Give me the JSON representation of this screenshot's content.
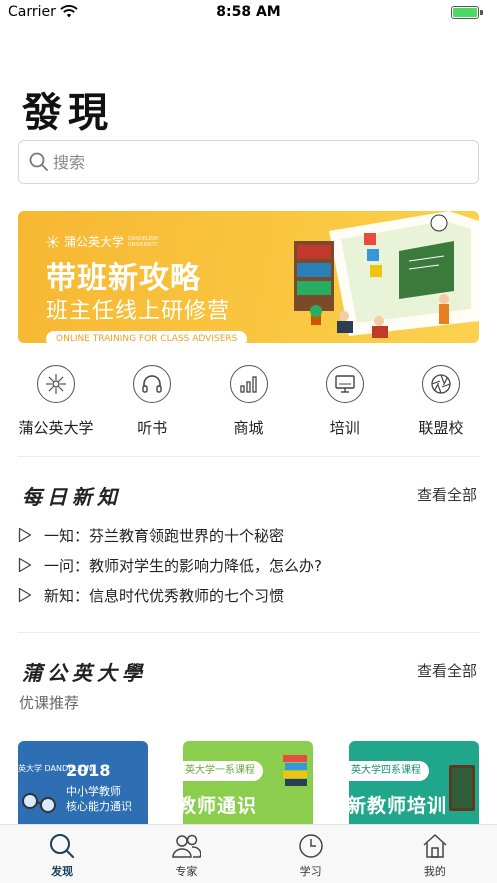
{
  "status_bar": {
    "carrier": "Carrier",
    "time": "8:58 AM",
    "battery_level": 1.0
  },
  "page": {
    "title": "發現"
  },
  "search": {
    "placeholder": "搜索"
  },
  "banner": {
    "brand": "蒲公英大学",
    "brand_sub_1": "DANDELION",
    "brand_sub_2": "UNIVERSITY",
    "title": "带班新攻略",
    "subtitle": "班主任线上研修营",
    "tag": "ONLINE TRAINING FOR CLASS ADVISERS"
  },
  "quick_nav": [
    {
      "label": "蒲公英大学",
      "icon": "dandelion-icon"
    },
    {
      "label": "听书",
      "icon": "headphones-icon"
    },
    {
      "label": "商城",
      "icon": "bar-chart-icon"
    },
    {
      "label": "培训",
      "icon": "monitor-icon"
    },
    {
      "label": "联盟校",
      "icon": "aperture-icon"
    }
  ],
  "daily": {
    "title": "每日新知",
    "view_all": "查看全部",
    "items": [
      {
        "prefix": "一知：",
        "text": "芬兰教育领跑世界的十个秘密"
      },
      {
        "prefix": "一问：",
        "text": "教师对学生的影响力降低，怎么办?"
      },
      {
        "prefix": "新知：",
        "text": "信息时代优秀教师的七个习惯"
      }
    ]
  },
  "university": {
    "title": "蒲公英大學",
    "view_all": "查看全部",
    "subtitle": "优课推荐",
    "courses": [
      {
        "brand": "英大学 DANDELION",
        "year": "2018",
        "line1": "中小学教师",
        "line2": "核心能力通识"
      },
      {
        "pill": "英大学一系课程",
        "big": "教师通识"
      },
      {
        "pill": "英大学四系课程",
        "big": "新教师培训"
      }
    ]
  },
  "tab_bar": {
    "tabs": [
      {
        "label": "发现",
        "icon": "search-icon",
        "active": true
      },
      {
        "label": "专家",
        "icon": "people-icon",
        "active": false
      },
      {
        "label": "学习",
        "icon": "clock-icon",
        "active": false
      },
      {
        "label": "我的",
        "icon": "home-icon",
        "active": false
      }
    ]
  },
  "colors": {
    "accent": "#17405f",
    "banner": "#f9c33d",
    "card_blue": "#2e6fb3",
    "card_green": "#8bcd4d",
    "card_teal": "#1fa68b"
  }
}
